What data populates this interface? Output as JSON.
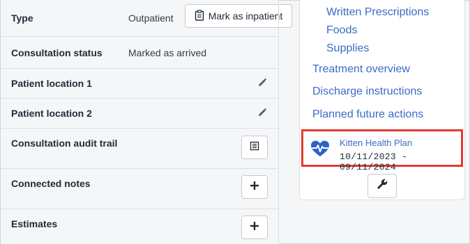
{
  "details": {
    "type": {
      "label": "Type",
      "value": "Outpatient",
      "button": "Mark as inpatient"
    },
    "consultation_status": {
      "label": "Consultation status",
      "value": "Marked as arrived"
    },
    "patient_location_1": {
      "label": "Patient location 1"
    },
    "patient_location_2": {
      "label": "Patient location 2"
    },
    "audit_trail": {
      "label": "Consultation audit trail"
    },
    "connected_notes": {
      "label": "Connected notes"
    },
    "estimates": {
      "label": "Estimates"
    }
  },
  "nav": {
    "sub_links": [
      "Written Prescriptions",
      "Foods",
      "Supplies"
    ],
    "links": [
      "Treatment overview",
      "Discharge instructions",
      "Planned future actions"
    ]
  },
  "health_plan": {
    "name": "Kitten Health Plan",
    "dates": "10/11/2023 - 09/11/2024",
    "icon": "heart-pulse-icon"
  },
  "colors": {
    "link": "#3b6cc4",
    "highlight": "#e53935",
    "heart": "#2f63c8"
  }
}
